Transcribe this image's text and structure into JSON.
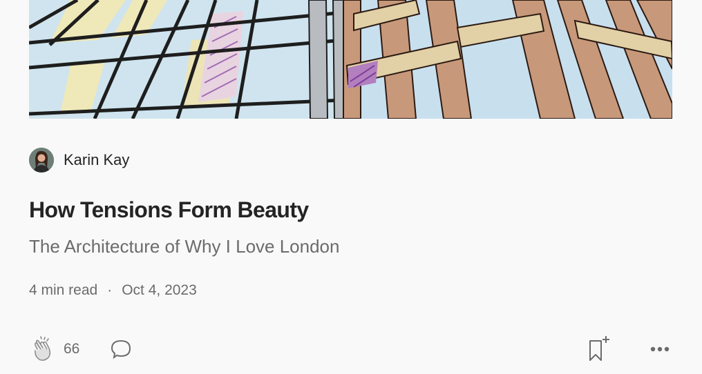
{
  "author": {
    "name": "Karin Kay",
    "avatar_icon": "avatar-photo"
  },
  "article": {
    "title": "How Tensions Form Beauty",
    "subtitle": "The Architecture of Why I Love London",
    "read_time": "4 min read",
    "separator": "·",
    "date": "Oct 4, 2023"
  },
  "actions": {
    "clap_count": "66",
    "clap_icon": "clap-icon",
    "response_icon": "response-bubble-icon",
    "bookmark_icon": "bookmark-add-icon",
    "more_icon": "more-icon"
  },
  "colors": {
    "text_primary": "#242424",
    "text_secondary": "#6b6b6b",
    "background": "#f9f9f9",
    "icon": "#6b6b6b"
  }
}
